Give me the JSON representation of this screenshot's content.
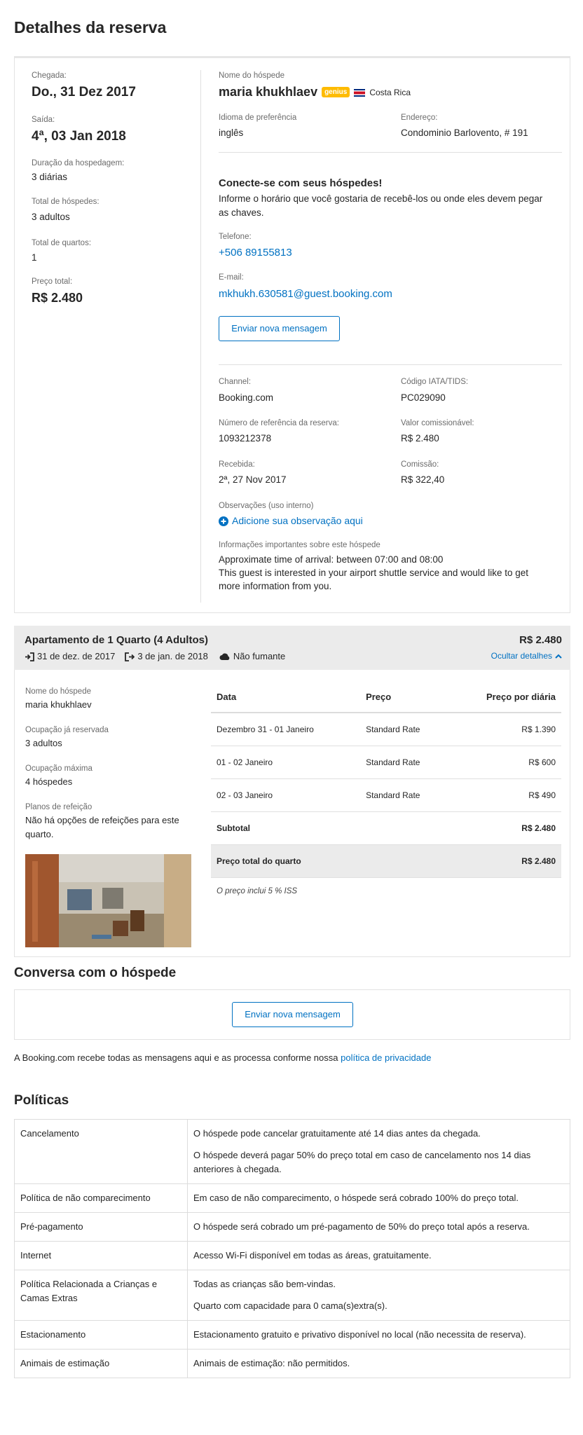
{
  "page_title": "Detalhes da reserva",
  "summary": {
    "checkin_label": "Chegada:",
    "checkin_value": "Do., 31 Dez 2017",
    "checkout_label": "Saída:",
    "checkout_value": "4ª, 03 Jan 2018",
    "duration_label": "Duração da hospedagem:",
    "duration_value": "3 diárias",
    "guests_label": "Total de hóspedes:",
    "guests_value": "3 adultos",
    "rooms_label": "Total de quartos:",
    "rooms_value": "1",
    "price_label": "Preço total:",
    "price_value": "R$ 2.480"
  },
  "guest": {
    "name_label": "Nome do hóspede",
    "name": "maria khukhlaev",
    "genius_badge": "genius",
    "country": "Costa Rica",
    "language_label": "Idioma de preferência",
    "language": "inglês",
    "address_label": "Endereço:",
    "address": "Condominio Barlovento, # 191"
  },
  "connect": {
    "title": "Conecte-se com seus hóspedes!",
    "text_line1": "Informe o horário que você gostaria de recebê-los ou onde eles devem pegar",
    "text_line2": "as chaves.",
    "phone_label": "Telefone:",
    "phone": "+506 89155813",
    "email_label": "E-mail:",
    "email": "mkhukh.630581@guest.booking.com",
    "send_button": "Enviar nova mensagem"
  },
  "booking_info": {
    "channel_label": "Channel:",
    "channel": "Booking.com",
    "iata_label": "Código IATA/TIDS:",
    "iata": "PC029090",
    "ref_label": "Número de referência da reserva:",
    "ref": "1093212378",
    "commissionable_label": "Valor comissionável:",
    "commissionable": "R$ 2.480",
    "received_label": "Recebida:",
    "received": "2ª, 27 Nov 2017",
    "commission_label": "Comissão:",
    "commission": "R$ 322,40",
    "notes_label": "Observações (uso interno)",
    "notes_link": "Adicione sua observação aqui",
    "important_label": "Informações importantes sobre este hóspede",
    "important_line1": "Approximate time of arrival: between 07:00 and 08:00",
    "important_line2": "This guest is interested in your airport shuttle service and would like to get",
    "important_line3": "more information from you."
  },
  "room": {
    "title": "Apartamento de 1 Quarto (4 Adultos)",
    "price": "R$ 2.480",
    "checkin": "31 de dez. de 2017",
    "checkout": "3 de jan. de 2018",
    "smoking": "Não fumante",
    "hide_details": "Ocultar detalhes",
    "guest_name_label": "Nome do hóspede",
    "guest_name": "maria khukhlaev",
    "occupancy_label": "Ocupação já reservada",
    "occupancy": "3 adultos",
    "max_occupancy_label": "Ocupação máxima",
    "max_occupancy": "4 hóspedes",
    "meal_label": "Planos de refeição",
    "meal_line1": "Não há opções de refeições para este",
    "meal_line2": "quarto.",
    "rates_headers": [
      "Data",
      "Preço",
      "Preço por diária"
    ],
    "rates": [
      {
        "date": "Dezembro 31 - 01 Janeiro",
        "rate": "Standard Rate",
        "price": "R$ 1.390"
      },
      {
        "date": "01 - 02 Janeiro",
        "rate": "Standard Rate",
        "price": "R$ 600"
      },
      {
        "date": "02 - 03 Janeiro",
        "rate": "Standard Rate",
        "price": "R$ 490"
      }
    ],
    "subtotal_label": "Subtotal",
    "subtotal": "R$ 2.480",
    "total_label": "Preço total do quarto",
    "total": "R$ 2.480",
    "tax_note": "O preço inclui 5 % ISS"
  },
  "conversation": {
    "title": "Conversa com o hóspede",
    "send_button": "Enviar nova mensagem",
    "privacy_text": "A Booking.com recebe todas as mensagens aqui e as processa conforme nossa ",
    "privacy_link": "política de privacidade"
  },
  "policies": {
    "title": "Políticas",
    "rows": [
      {
        "name": "Cancelamento",
        "lines": [
          "O hóspede pode cancelar gratuitamente até 14 dias antes da chegada.",
          "O hóspede deverá pagar 50% do preço total em caso de cancelamento nos 14 dias anteriores à chegada."
        ]
      },
      {
        "name": "Política de não comparecimento",
        "lines": [
          "Em caso de não comparecimento, o hóspede será cobrado 100% do preço total."
        ]
      },
      {
        "name": "Pré-pagamento",
        "lines": [
          "O hóspede será cobrado um pré-pagamento de 50% do preço total após a reserva."
        ]
      },
      {
        "name": "Internet",
        "lines": [
          "Acesso Wi-Fi disponível em todas as áreas, gratuitamente."
        ]
      },
      {
        "name": "Política Relacionada a Crianças e Camas Extras",
        "lines": [
          "Todas as crianças são bem-vindas.",
          "Quarto com capacidade para 0 cama(s)extra(s)."
        ]
      },
      {
        "name": "Estacionamento",
        "lines": [
          "Estacionamento gratuito e privativo disponível no local (não necessita de reserva)."
        ]
      },
      {
        "name": "Animais de estimação",
        "lines": [
          "Animais de estimação: não permitidos."
        ]
      }
    ]
  }
}
